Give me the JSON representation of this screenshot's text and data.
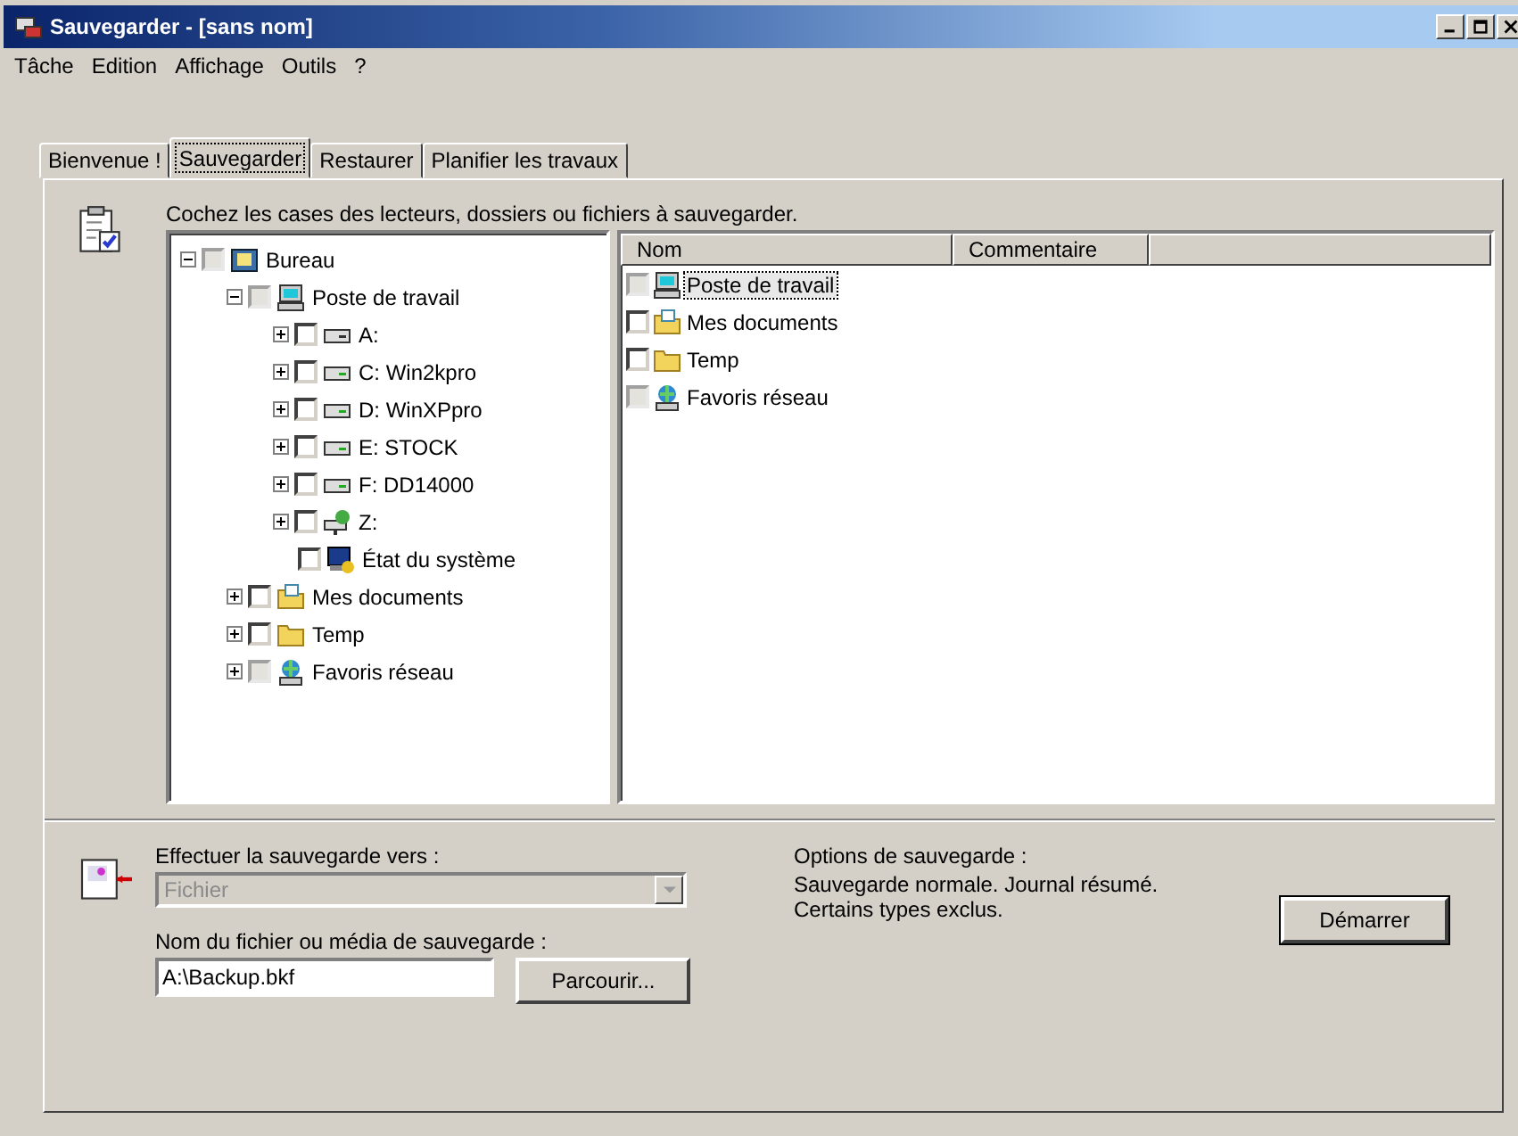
{
  "window": {
    "title": "Sauvegarder - [sans nom]"
  },
  "menu": [
    "Tâche",
    "Edition",
    "Affichage",
    "Outils",
    "?"
  ],
  "tabs": [
    {
      "label": "Bienvenue !",
      "selected": false
    },
    {
      "label": "Sauvegarder",
      "selected": true
    },
    {
      "label": "Restaurer",
      "selected": false
    },
    {
      "label": "Planifier les travaux",
      "selected": false
    }
  ],
  "instruction": "Cochez les cases des lecteurs, dossiers ou fichiers à sauvegarder.",
  "tree": [
    {
      "label": "Bureau",
      "kind": "desktop",
      "expanded": true,
      "partial": true,
      "children": [
        {
          "label": "Poste de travail",
          "kind": "computer",
          "expanded": true,
          "partial": true,
          "children": [
            {
              "label": "A:",
              "kind": "floppy",
              "expanded": false,
              "partial": false
            },
            {
              "label": "C: Win2kpro",
              "kind": "drive",
              "expanded": false,
              "partial": false
            },
            {
              "label": "D: WinXPpro",
              "kind": "drive",
              "expanded": false,
              "partial": false
            },
            {
              "label": "E: STOCK",
              "kind": "drive",
              "expanded": false,
              "partial": false
            },
            {
              "label": "F: DD14000",
              "kind": "drive",
              "expanded": false,
              "partial": false
            },
            {
              "label": "Z:",
              "kind": "netdrive",
              "expanded": false,
              "partial": false
            },
            {
              "label": "État du système",
              "kind": "system",
              "partial": false
            }
          ]
        },
        {
          "label": "Mes documents",
          "kind": "documents",
          "expanded": false,
          "partial": false
        },
        {
          "label": "Temp",
          "kind": "folder",
          "expanded": false,
          "partial": false
        },
        {
          "label": "Favoris réseau",
          "kind": "network",
          "expanded": false,
          "partial": true
        }
      ]
    }
  ],
  "list": {
    "columns": [
      "Nom",
      "Commentaire"
    ],
    "rows": [
      {
        "label": "Poste de travail",
        "kind": "computer",
        "partial": true,
        "selected": true
      },
      {
        "label": "Mes documents",
        "kind": "documents",
        "partial": false,
        "selected": false
      },
      {
        "label": "Temp",
        "kind": "folder",
        "partial": false,
        "selected": false
      },
      {
        "label": "Favoris réseau",
        "kind": "network",
        "partial": true,
        "selected": false
      }
    ]
  },
  "destination": {
    "label": "Effectuer la sauvegarde vers :",
    "value": "Fichier",
    "disabled": true
  },
  "media": {
    "label": "Nom du fichier ou média de sauvegarde :",
    "value": "A:\\Backup.bkf",
    "button": "Parcourir..."
  },
  "options": {
    "title": "Options de sauvegarde :",
    "text": "Sauvegarde normale. Journal résumé. Certains types exclus."
  },
  "start_button": "Démarrer"
}
